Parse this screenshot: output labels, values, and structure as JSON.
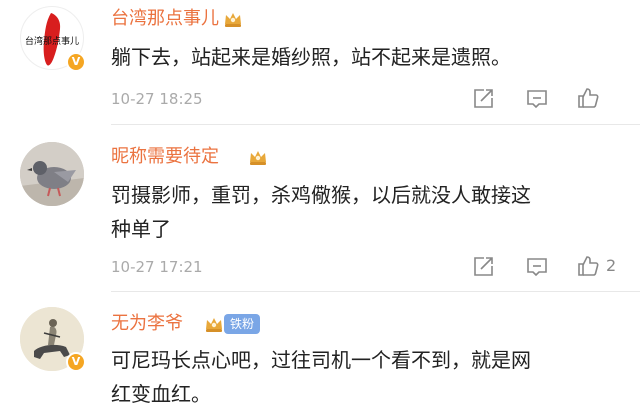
{
  "comments": [
    {
      "username": "台湾那点事儿",
      "avatar_text": "台湾那点事儿",
      "verified_badge": "V",
      "text": "躺下去，站起来是婚纱照，站不起来是遗照。",
      "time": "10-27 18:25",
      "like_count": ""
    },
    {
      "username": "昵称需要待定",
      "text_line1": "罚摄影师，重罚，杀鸡儆猴，以后就没人敢接这",
      "text_line2": "种单了",
      "time": "10-27 17:21",
      "like_count": "2"
    },
    {
      "username": "无为李爷",
      "fan_badge": "铁粉",
      "verified_badge": "V",
      "text_line1": "可尼玛长点心吧，过往司机一个看不到，就是网",
      "text_line2": "红变血红。"
    }
  ],
  "colors": {
    "username": "#eb7340",
    "time": "#aaaaaa",
    "text": "#222222",
    "verified": "#f5a623",
    "fan_badge": "#7aa6e6",
    "crown": "#e8a83a"
  },
  "icons": [
    "crown-icon",
    "share-icon",
    "comment-icon",
    "like-icon"
  ]
}
